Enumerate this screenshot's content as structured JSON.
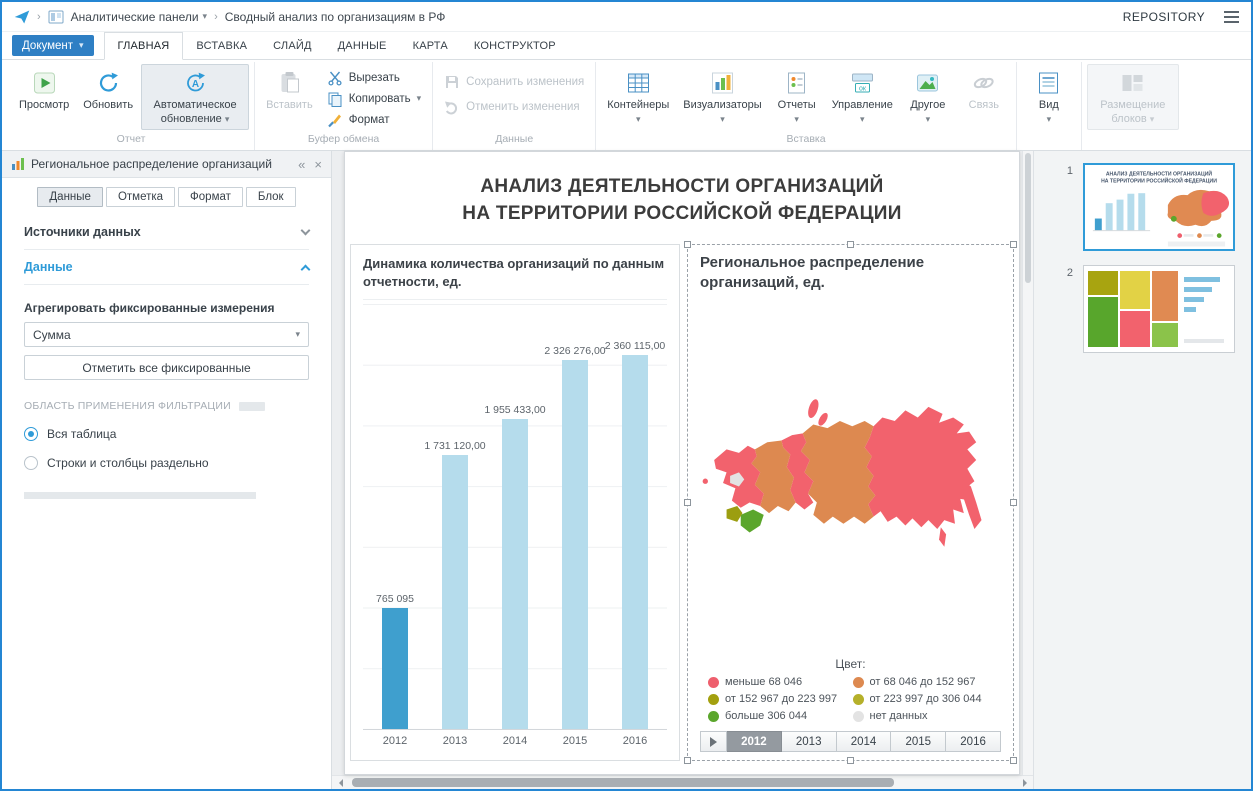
{
  "topbar": {
    "breadcrumb_section": "Аналитические панели",
    "breadcrumb_document": "Сводный анализ по организациям в РФ",
    "repository": "REPOSITORY"
  },
  "ribbon": {
    "document_button": "Документ",
    "tabs": [
      "ГЛАВНАЯ",
      "ВСТАВКА",
      "СЛАЙД",
      "ДАННЫЕ",
      "КАРТА",
      "КОНСТРУКТОР"
    ],
    "active_tab_index": 0,
    "groups": {
      "report": {
        "label": "Отчет",
        "preview": "Просмотр",
        "refresh": "Обновить",
        "auto_refresh": "Автоматическое обновление"
      },
      "clipboard": {
        "label": "Буфер обмена",
        "paste": "Вставить",
        "cut": "Вырезать",
        "copy": "Копировать",
        "format": "Формат"
      },
      "data": {
        "label": "Данные",
        "save": "Сохранить изменения",
        "undo": "Отменить изменения"
      },
      "insert": {
        "label": "Вставка",
        "containers": "Контейнеры",
        "visualizers": "Визуализаторы",
        "reports": "Отчеты",
        "management": "Управление",
        "other": "Другое",
        "link": "Связь"
      },
      "view": {
        "view": "Вид"
      },
      "layout": {
        "blocks": "Размещение блоков"
      }
    }
  },
  "panel": {
    "title": "Региональное распределение организаций",
    "tabs": [
      "Данные",
      "Отметка",
      "Формат",
      "Блок"
    ],
    "active_tab_index": 0,
    "sources_section": "Источники данных",
    "data_section": "Данные",
    "aggregate_label": "Агрегировать фиксированные измерения",
    "aggregate_value": "Сумма",
    "mark_all_button": "Отметить все фиксированные",
    "filter_scope_label": "ОБЛАСТЬ ПРИМЕНЕНИЯ ФИЛЬТРАЦИИ",
    "radio_options": [
      {
        "label": "Вся таблица",
        "selected": true
      },
      {
        "label": "Строки и столбцы раздельно",
        "selected": false
      }
    ]
  },
  "slide": {
    "title_line1": "АНАЛИЗ ДЕЯТЕЛЬНОСТИ ОРГАНИЗАЦИЙ",
    "title_line2": "НА ТЕРРИТОРИИ РОССИЙСКОЙ ФЕДЕРАЦИИ",
    "map": {
      "title": "Региональное распределение организаций, ед.",
      "legend_title": "Цвет:",
      "legend": [
        {
          "label": "меньше 68 046",
          "color": "#ee5f6d"
        },
        {
          "label": "от 68 046 до 152 967",
          "color": "#dd8950"
        },
        {
          "label": "от 152 967 до 223 997",
          "color": "#a3a00f"
        },
        {
          "label": "от 223 997 до 306 044",
          "color": "#b5b02a"
        },
        {
          "label": "больше 306 044",
          "color": "#5ba62c"
        },
        {
          "label": "нет данных",
          "color": "#e3e3e3"
        }
      ],
      "years": [
        "2012",
        "2013",
        "2014",
        "2015",
        "2016"
      ],
      "selected_year": "2012"
    }
  },
  "chart_data": {
    "type": "bar",
    "title": "Динамика количества организаций по данным отчетности, ед.",
    "categories": [
      "2012",
      "2013",
      "2014",
      "2015",
      "2016"
    ],
    "values": [
      765095,
      1731120,
      1955433,
      2326276,
      2360115
    ],
    "value_labels": [
      "765 095",
      "1 731 120,00",
      "1 955 433,00",
      "2 326 276,00",
      "2 360 115,00"
    ],
    "selected_index": 0,
    "bar_color": "#b5dcec",
    "selected_bar_color": "#3f9fce",
    "xlabel": "",
    "ylabel": "",
    "ylim": [
      0,
      2500000
    ],
    "grid": true,
    "legend_position": "none"
  },
  "slides_panel": {
    "slides": [
      {
        "number": "1",
        "selected": true
      },
      {
        "number": "2",
        "selected": false
      }
    ]
  }
}
